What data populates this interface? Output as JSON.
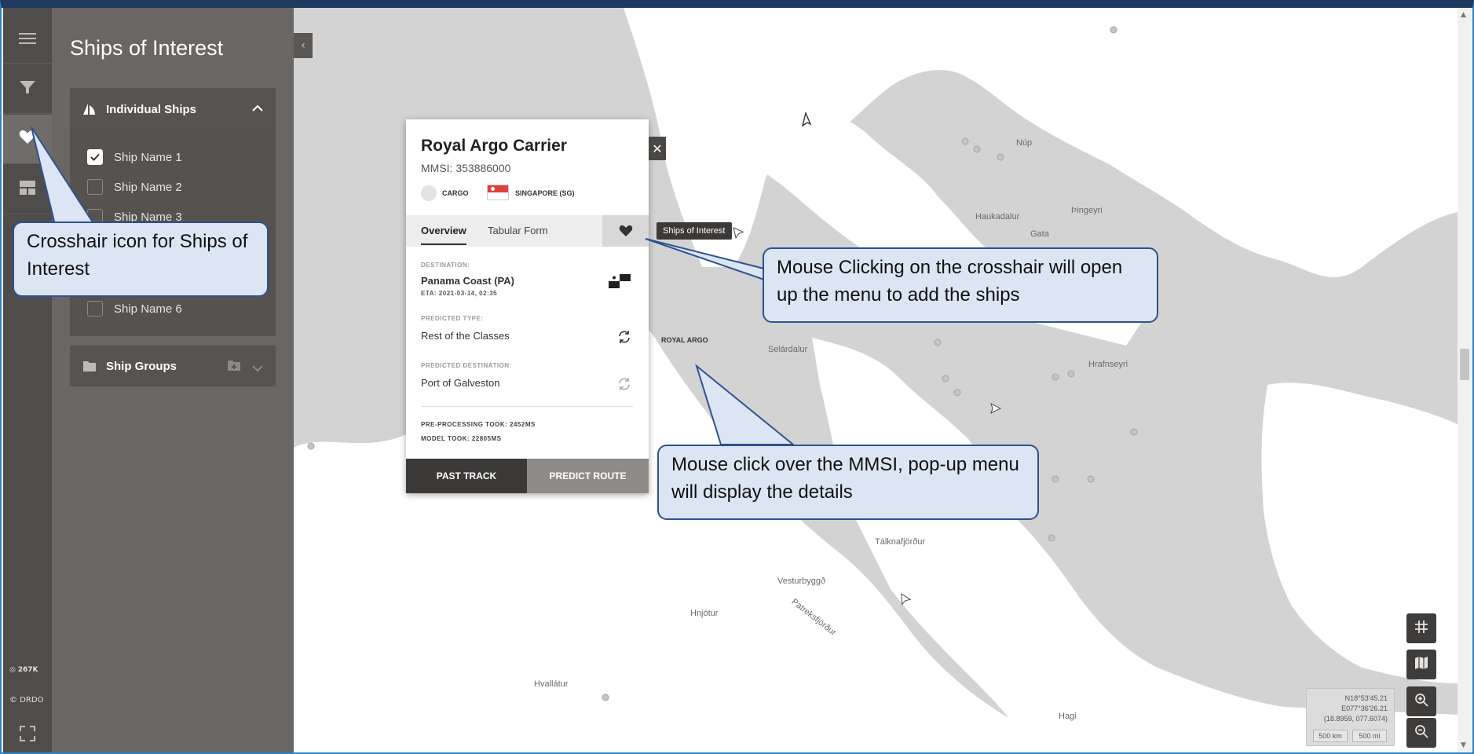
{
  "panel": {
    "title": "Ships of Interest",
    "individual_ships": {
      "label": "Individual Ships",
      "ships": [
        {
          "label": "Ship Name 1",
          "checked": true
        },
        {
          "label": "Ship Name 2",
          "checked": false
        },
        {
          "label": "Ship Name 3",
          "checked": false
        },
        {
          "label": "Ship Name 6",
          "checked": false
        }
      ]
    },
    "ship_groups": {
      "label": "Ship Groups"
    }
  },
  "rail": {
    "count": "267K",
    "copyright": "© DRDO"
  },
  "popup": {
    "title": "Royal Argo Carrier",
    "mmsi": "MMSI: 353886000",
    "type": "CARGO",
    "flag": "SINGAPORE (SG)",
    "tabs": [
      "Overview",
      "Tabular Form"
    ],
    "soi_tooltip": "Ships of Interest",
    "destination_caption": "DESTINATION:",
    "destination": "Panama Coast (PA)",
    "eta": "ETA: 2021-03-14, 02:35",
    "predicted_type_caption": "PREDICTED TYPE:",
    "predicted_type": "Rest of the Classes",
    "predicted_destination_caption": "PREDICTED DESTINATION:",
    "predicted_destination": "Port of Galveston",
    "preprocessing": "PRE-PROCESSING TOOK:  2452MS",
    "model": "MODEL TOOK:  22805MS",
    "past_track": "PAST TRACK",
    "predict_route": "PREDICT ROUTE"
  },
  "map": {
    "ship_label": "ROYAL ARGO",
    "places": [
      "Núp",
      "Haukadalur",
      "Gata",
      "Þingeyri",
      "Selárdalur",
      "Hrafnseyri",
      "Tálknafjörður",
      "Vesturbyggð",
      "Patreksfjörður",
      "Hnjótur",
      "Hvallátur",
      "Hagi"
    ],
    "coords": [
      "N18°53'45.21",
      "E077°36'26.21",
      "(18.8959, 077.6074)"
    ],
    "scale": [
      "500 km",
      "500 mi"
    ]
  },
  "callouts": {
    "crosshair": "Crosshair icon for Ships of Interest",
    "mouse_click": "Mouse Clicking on the crosshair will open up the menu to add the ships",
    "mmsi": "Mouse click over the MMSI, pop-up menu will display the details"
  }
}
